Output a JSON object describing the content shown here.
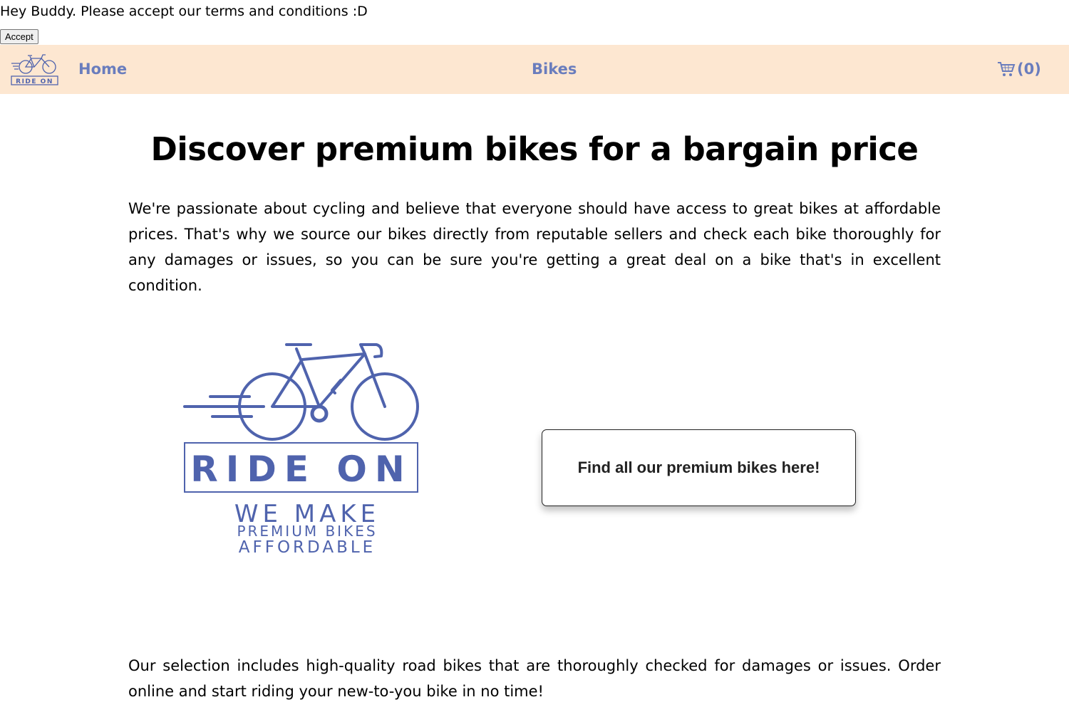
{
  "terms_banner": {
    "message": "Hey Buddy. Please accept our terms and conditions :D",
    "accept_label": "Accept"
  },
  "nav": {
    "logo_text": "RIDE ON",
    "home_label": "Home",
    "bikes_label": "Bikes",
    "cart_count": "(0)",
    "cart_icon": "shopping-cart-icon",
    "link_color": "#6a7dbd",
    "background_color": "#fde7d1"
  },
  "hero": {
    "title": "Discover premium bikes for a bargain price",
    "intro": "We're passionate about cycling and believe that everyone should have access to great bikes at affordable prices. That's why we source our bikes directly from reputable sellers and check each bike thoroughly for any damages or issues, so you can be sure you're getting a great deal on a bike that's in excellent condition."
  },
  "logo": {
    "brand": "RIDE ON",
    "tagline_1": "WE MAKE",
    "tagline_2": "PREMIUM BIKES",
    "tagline_3": "AFFORDABLE",
    "brand_color": "#4f63ad"
  },
  "cta": {
    "label": "Find all our premium bikes here!"
  },
  "selection": {
    "text": "Our selection includes high-quality road bikes that are thoroughly checked for damages or issues. Order online and start riding your new-to-you bike in no time!"
  }
}
